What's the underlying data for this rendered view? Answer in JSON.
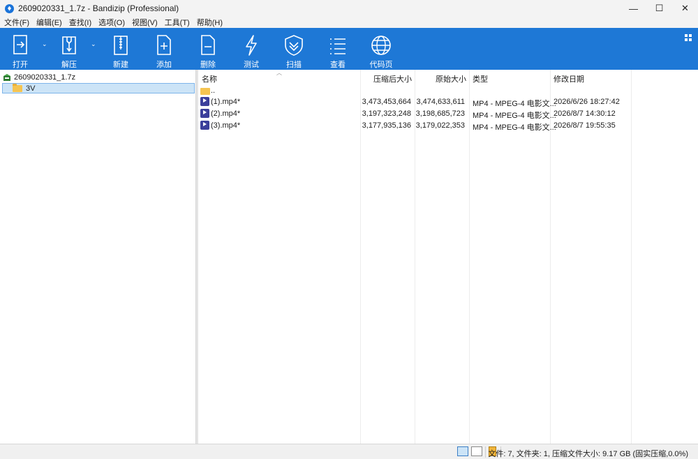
{
  "window": {
    "title": "2609020331_1.7z - Bandizip (Professional)",
    "controls": {
      "minimize": "—",
      "maximize": "☐",
      "close": "✕"
    }
  },
  "menu": [
    {
      "label": "文件(F)"
    },
    {
      "label": "编辑(E)"
    },
    {
      "label": "查找(I)"
    },
    {
      "label": "选项(O)"
    },
    {
      "label": "视图(V)"
    },
    {
      "label": "工具(T)"
    },
    {
      "label": "帮助(H)"
    }
  ],
  "toolbar": {
    "open": "打开",
    "extract": "解压",
    "new": "新建",
    "add": "添加",
    "delete": "删除",
    "test": "测试",
    "scan": "扫描",
    "view": "查看",
    "codepage": "代码页"
  },
  "tree": {
    "root": "2609020331_1.7z",
    "child": "3V"
  },
  "list": {
    "columns": {
      "name": "名称",
      "packed": "压缩后大小",
      "original": "原始大小",
      "type": "类型",
      "modified": "修改日期"
    },
    "up_entry": "..",
    "rows": [
      {
        "name": "(1).mp4*",
        "packed": "3,473,453,664",
        "original": "3,474,633,611",
        "type": "MP4 - MPEG-4 电影文...",
        "modified": "2026/6/26 18:27:42"
      },
      {
        "name": "(2).mp4*",
        "packed": "3,197,323,248",
        "original": "3,198,685,723",
        "type": "MP4 - MPEG-4 电影文...",
        "modified": "2026/8/7 14:30:12"
      },
      {
        "name": "(3).mp4*",
        "packed": "3,177,935,136",
        "original": "3,179,022,353",
        "type": "MP4 - MPEG-4 电影文...",
        "modified": "2026/8/7 19:55:35"
      }
    ]
  },
  "status": {
    "text": "文件: 7, 文件夹: 1, 压缩文件大小: 9.17 GB (固实压缩,0.0%)"
  },
  "colors": {
    "toolbar": "#1e78d6",
    "selection": "#cce4f7",
    "mp4_icon": "#3b3f9b",
    "folder": "#f5c451"
  }
}
